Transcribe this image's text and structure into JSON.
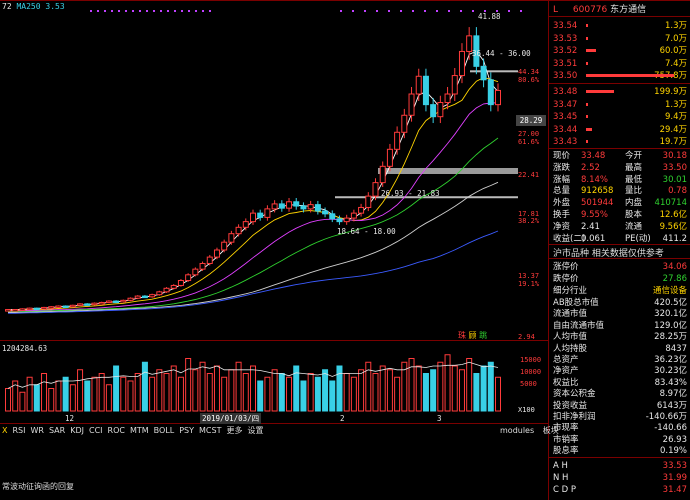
{
  "colors": {
    "up": "#ff3b3b",
    "down": "#39d0e6",
    "ma5": "#ffffff",
    "ma10": "#ffd400",
    "ma20": "#e040ff",
    "ma30": "#2fd12f",
    "ma60": "#cfcfcf",
    "ma120": "#3b5bff",
    "bg": "#000000",
    "frame": "#7a0000"
  },
  "header": {
    "left_label": "72",
    "ma_label": "MA250",
    "ma_value": "3.53"
  },
  "price_axis": [
    "44.34",
    "80.6%",
    "30.29",
    "27.00",
    "61.6%",
    "22.41",
    "17.81",
    "38.2%",
    "13.37",
    "19.1%",
    "2.94"
  ],
  "chart_annotations": {
    "high": "41.88",
    "range_top": "36.44 - 36.00",
    "range_mid": "26.93 - 21.83",
    "range_low": "18.64 - 18.00",
    "current_badge": "28.29",
    "date_tag": "2019/01/03/四",
    "month_1": "12",
    "month_2": "2",
    "month_3": "3",
    "signal_1": "珠",
    "signal_2": "顾",
    "signal_3": "跳"
  },
  "volume": {
    "label": "1204284.63",
    "ticks": [
      "15000",
      "10000",
      "5000"
    ],
    "unit": "X100"
  },
  "chart_data": {
    "type": "bar",
    "series": [
      {
        "name": "价格",
        "values": [
          2.6,
          2.6,
          2.7,
          2.8,
          2.7,
          2.9,
          3.0,
          3.1,
          3.0,
          3.2,
          3.4,
          3.3,
          3.5,
          3.6,
          3.8,
          3.7,
          3.9,
          4.2,
          4.5,
          4.4,
          4.7,
          5.1,
          5.6,
          6.0,
          6.7,
          7.5,
          8.3,
          9.1,
          10.0,
          11.0,
          12.1,
          13.3,
          14.2,
          15.0,
          16.2,
          15.6,
          16.8,
          17.5,
          16.9,
          17.8,
          17.2,
          16.8,
          17.4,
          16.5,
          16.1,
          15.4,
          15.0,
          15.5,
          16.2,
          17.0,
          18.6,
          20.5,
          22.8,
          25.2,
          27.6,
          30.0,
          33.0,
          35.5,
          31.5,
          29.8,
          31.8,
          33.0,
          35.6,
          39.0,
          41.2,
          36.9,
          35.0,
          31.5,
          33.5
        ]
      }
    ]
  },
  "indicator_tabs": [
    "X",
    "RSI",
    "WR",
    "SAR",
    "KDJ",
    "CCI",
    "ROC",
    "MTM",
    "BOLL",
    "PSY",
    "MCST",
    "更多",
    "设置"
  ],
  "right_tabs": [
    "modules",
    "板块"
  ],
  "status": "常波动征询函的回复",
  "quote": {
    "code": "600776",
    "name": "东方通信",
    "ask": [
      [
        "33.54",
        "1.3万"
      ],
      [
        "33.53",
        "7.0万"
      ],
      [
        "33.52",
        "60.0万"
      ],
      [
        "33.51",
        "7.4万"
      ],
      [
        "33.50",
        "757.8万"
      ]
    ],
    "bid": [
      [
        "33.48",
        "199.9万"
      ],
      [
        "33.47",
        "1.3万"
      ],
      [
        "33.45",
        "9.4万"
      ],
      [
        "33.44",
        "29.4万"
      ],
      [
        "33.43",
        "19.7万"
      ]
    ],
    "stats": [
      [
        "现价",
        "33.48",
        "今开",
        "30.18"
      ],
      [
        "涨跌",
        "2.52",
        "最高",
        "33.50"
      ],
      [
        "涨幅",
        "8.14%",
        "最低",
        "30.01"
      ],
      [
        "总量",
        "912658",
        "量比",
        "0.78"
      ],
      [
        "外盘",
        "501944",
        "内盘",
        "410714"
      ],
      [
        "换手",
        "9.55%",
        "股本",
        "12.6亿"
      ],
      [
        "净资",
        "2.41",
        "流通",
        "9.56亿"
      ],
      [
        "收益(二)",
        "0.061",
        "PE(动)",
        "411.2"
      ]
    ],
    "section_title": "沪市品种 相关数据仅供参考",
    "rise": [
      "涨停价",
      "34.06"
    ],
    "fall": [
      "跌停价",
      "27.86"
    ],
    "industry": [
      "细分行业",
      "通信设备"
    ],
    "fin": [
      [
        "AB股总市值",
        "420.5亿"
      ],
      [
        "流通市值",
        "320.1亿"
      ],
      [
        "自由流通市值",
        "129.0亿"
      ],
      [
        "人均市值",
        "28.25万"
      ],
      [
        "人均持股",
        "8437"
      ],
      [
        "总资产",
        "36.23亿"
      ],
      [
        "净资产",
        "30.23亿"
      ],
      [
        "权益比",
        "83.43%"
      ],
      [
        "资本公积金",
        "8.97亿"
      ],
      [
        "投资收益",
        "6143万"
      ],
      [
        "扣非净利润",
        "-140.66万"
      ],
      [
        "市现率",
        "-140.66"
      ],
      [
        "市销率",
        "26.93"
      ],
      [
        "股息率",
        "0.19%"
      ]
    ],
    "tail": [
      [
        "A H",
        "33.53"
      ],
      [
        "N H",
        "31.99"
      ],
      [
        "C D P",
        "31.47"
      ]
    ]
  }
}
